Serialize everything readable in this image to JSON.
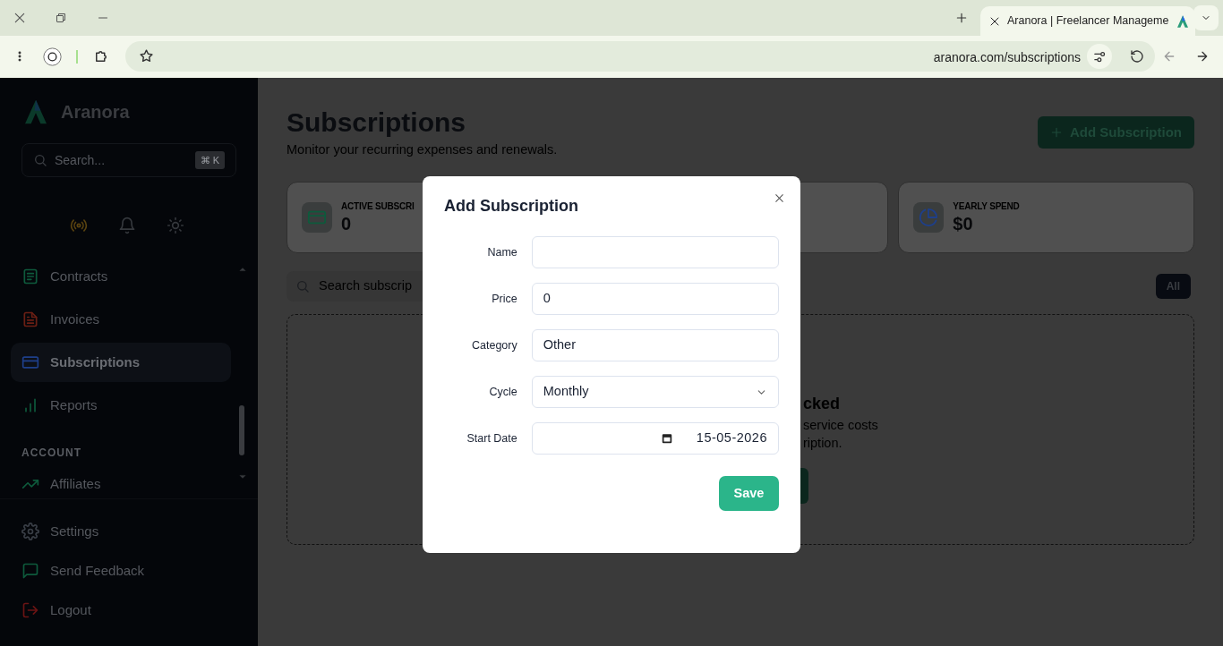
{
  "browser": {
    "tab_title": "Aranora | Freelancer Manageme",
    "url": "aranora.com/subscriptions"
  },
  "sidebar": {
    "brand": "Aranora",
    "search": {
      "placeholder": "Search...",
      "shortcut": "⌘ K"
    },
    "items": [
      {
        "kind": "link",
        "label": "Contracts",
        "selected": false
      },
      {
        "kind": "link",
        "label": "Invoices",
        "selected": false
      },
      {
        "kind": "link",
        "label": "Subscriptions",
        "selected": true
      },
      {
        "kind": "link",
        "label": "Reports",
        "selected": false
      },
      {
        "kind": "heading",
        "label": "ACCOUNT"
      },
      {
        "kind": "link",
        "label": "Affiliates",
        "selected": false
      }
    ],
    "footer": [
      {
        "label": "Settings"
      },
      {
        "label": "Send Feedback"
      },
      {
        "label": "Logout"
      }
    ]
  },
  "page": {
    "title": "Subscriptions",
    "subtitle": "Monitor your recurring expenses and renewals.",
    "add_button": "Add Subscription",
    "stats": [
      {
        "label": "ACTIVE SUBSCRI",
        "value": "0"
      },
      {
        "label": "YEARLY SPEND",
        "value": "$0"
      }
    ],
    "search": {
      "placeholder": "Search subscrip"
    },
    "filter": {
      "label": "All",
      "selected": true
    },
    "empty": {
      "title": "cked",
      "lines": [
        "service costs",
        "ription."
      ]
    }
  },
  "dialog": {
    "title": "Add Subscription",
    "fields": [
      {
        "kind": "text",
        "label": "Name"
      },
      {
        "kind": "text",
        "label": "Price",
        "value": "0"
      },
      {
        "kind": "text",
        "label": "Category",
        "value": "Other"
      },
      {
        "kind": "select",
        "label": "Cycle",
        "value": "Monthly"
      },
      {
        "kind": "date",
        "label": "Start Date",
        "value": "15-05-2026"
      }
    ],
    "save": "Save"
  }
}
